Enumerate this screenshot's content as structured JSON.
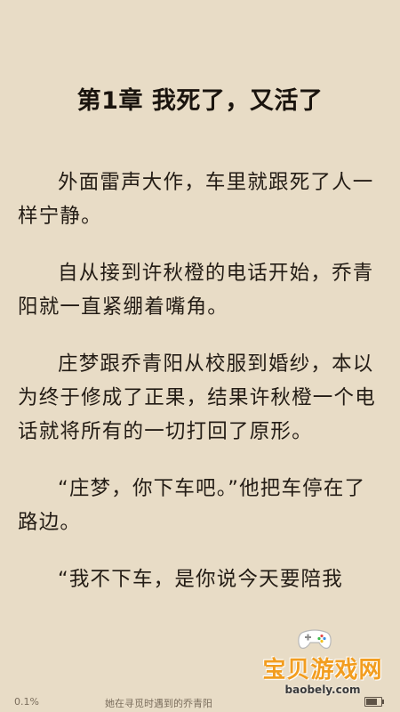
{
  "chapter": {
    "title": "第1章 我死了，又活了"
  },
  "paragraphs": [
    "外面雷声大作，车里就跟死了人一样宁静。",
    "自从接到许秋橙的电话开始，乔青阳就一直紧绷着嘴角。",
    "庄梦跟乔青阳从校服到婚纱，本以为终于修成了正果，结果许秋橙一个电话就将所有的一切打回了原形。",
    "“庄梦，你下车吧。”他把车停在了路边。",
    "“我不下车，是你说今天要陪我"
  ],
  "footer": {
    "progress": "0.1%",
    "book_name": "她在寻觅时遇到的乔青阳"
  },
  "battery": {
    "level": 0.85
  },
  "watermark": {
    "cn": "宝贝游戏网",
    "en": "baobely.com"
  }
}
